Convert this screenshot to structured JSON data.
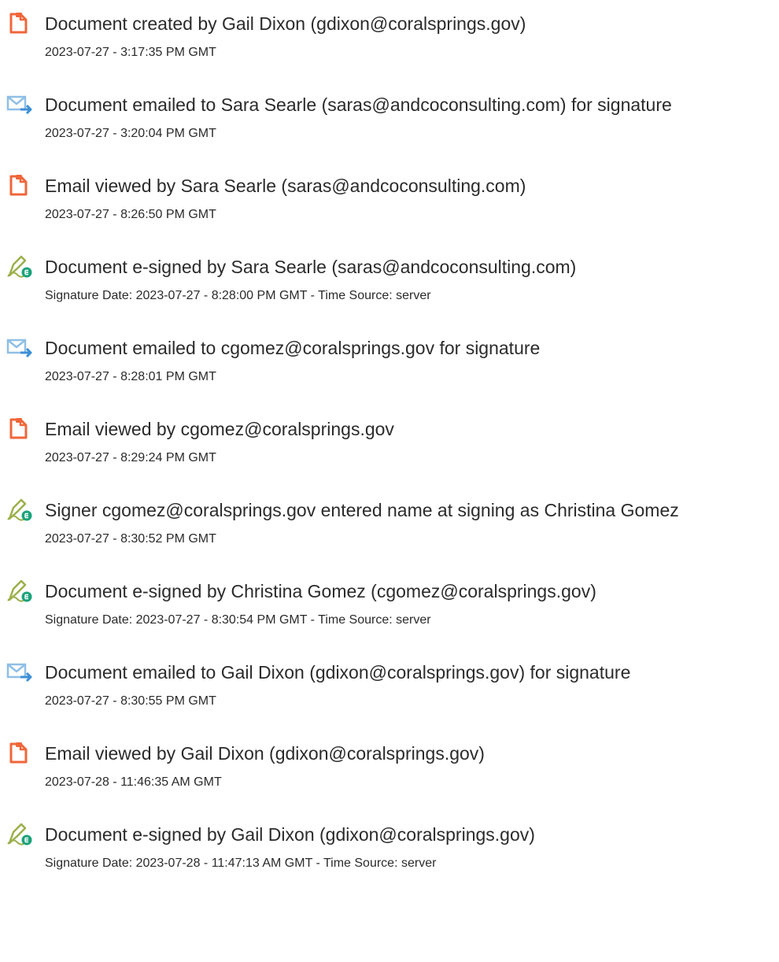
{
  "events": [
    {
      "icon": "document-icon",
      "text": "Document created by Gail Dixon (gdixon@coralsprings.gov)",
      "time": "2023-07-27 - 3:17:35 PM GMT"
    },
    {
      "icon": "email-send-icon",
      "text": "Document emailed to Sara Searle (saras@andcoconsulting.com) for signature",
      "time": "2023-07-27 - 3:20:04 PM GMT"
    },
    {
      "icon": "document-icon",
      "text": "Email viewed by Sara Searle (saras@andcoconsulting.com)",
      "time": "2023-07-27 - 8:26:50 PM GMT"
    },
    {
      "icon": "esign-pen-icon",
      "text": "Document e-signed by Sara Searle (saras@andcoconsulting.com)",
      "time": "Signature Date: 2023-07-27 - 8:28:00 PM GMT - Time Source: server"
    },
    {
      "icon": "email-send-icon",
      "text": "Document emailed to cgomez@coralsprings.gov for signature",
      "time": "2023-07-27 - 8:28:01 PM GMT"
    },
    {
      "icon": "document-icon",
      "text": "Email viewed by cgomez@coralsprings.gov",
      "time": "2023-07-27 - 8:29:24 PM GMT"
    },
    {
      "icon": "esign-pen-icon",
      "text": "Signer cgomez@coralsprings.gov entered name at signing as Christina Gomez",
      "time": "2023-07-27 - 8:30:52 PM GMT"
    },
    {
      "icon": "esign-pen-icon",
      "text": "Document e-signed by Christina Gomez (cgomez@coralsprings.gov)",
      "time": "Signature Date: 2023-07-27 - 8:30:54 PM GMT - Time Source: server"
    },
    {
      "icon": "email-send-icon",
      "text": "Document emailed to Gail Dixon (gdixon@coralsprings.gov) for signature",
      "time": "2023-07-27 - 8:30:55 PM GMT"
    },
    {
      "icon": "document-icon",
      "text": "Email viewed by Gail Dixon (gdixon@coralsprings.gov)",
      "time": "2023-07-28 - 11:46:35 AM GMT"
    },
    {
      "icon": "esign-pen-icon",
      "text": "Document e-signed by Gail Dixon (gdixon@coralsprings.gov)",
      "time": "Signature Date: 2023-07-28 - 11:47:13 AM GMT - Time Source: server"
    }
  ],
  "colors": {
    "text": "#2b2b2b",
    "document_icon": "#f0663a",
    "email_icon": "#8fbfe6",
    "pen_icon": "#9ab04a",
    "pen_badge": "#1aa37a"
  }
}
